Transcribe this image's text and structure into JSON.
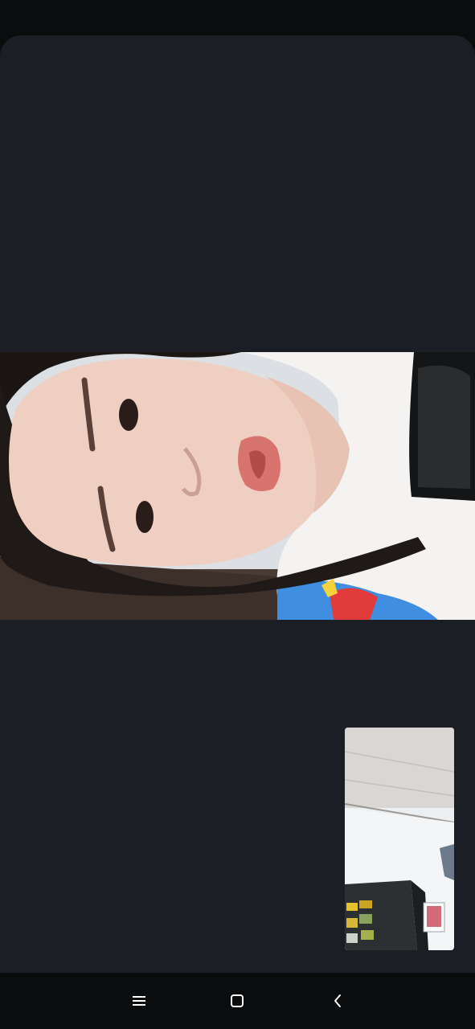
{
  "screen": {
    "type": "video-call",
    "panel_color": "#1b1e24",
    "background_color": "#0b0c0e"
  },
  "remote_video": {
    "content": "remote-participant-video-frame"
  },
  "local_video": {
    "content": "self-view-camera-frame"
  },
  "nav_bar": {
    "buttons": [
      {
        "name": "menu",
        "icon": "menu-icon"
      },
      {
        "name": "home",
        "icon": "home-icon"
      },
      {
        "name": "back",
        "icon": "back-icon"
      }
    ],
    "icon_color": "#ffffff"
  }
}
